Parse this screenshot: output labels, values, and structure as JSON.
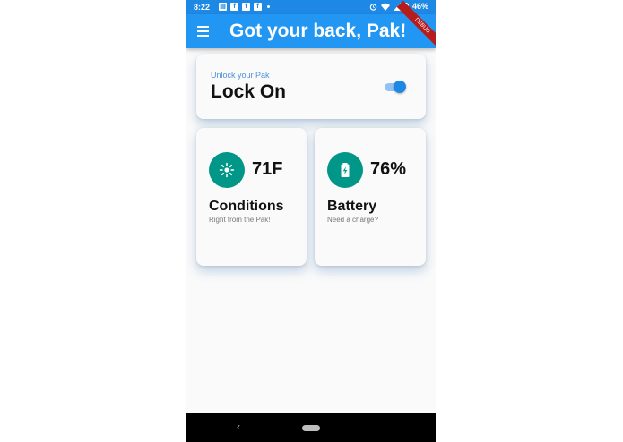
{
  "status_bar": {
    "time": "8:22",
    "battery": "46%"
  },
  "app_bar": {
    "title": "Got your back, Pak!",
    "debug": "DEBUG"
  },
  "lock_card": {
    "subtitle": "Unlock your Pak",
    "status": "Lock On",
    "toggle_on": true
  },
  "tiles": [
    {
      "value": "71F",
      "label": "Conditions",
      "desc": "Right from the Pak!",
      "icon": "sun-icon"
    },
    {
      "value": "76%",
      "label": "Battery",
      "desc": "Need a charge?",
      "icon": "battery-charging-icon"
    }
  ],
  "nav": {
    "back": "‹"
  },
  "colors": {
    "primary": "#2196f3",
    "accent": "#009688",
    "toggle": "#1e88e5"
  }
}
